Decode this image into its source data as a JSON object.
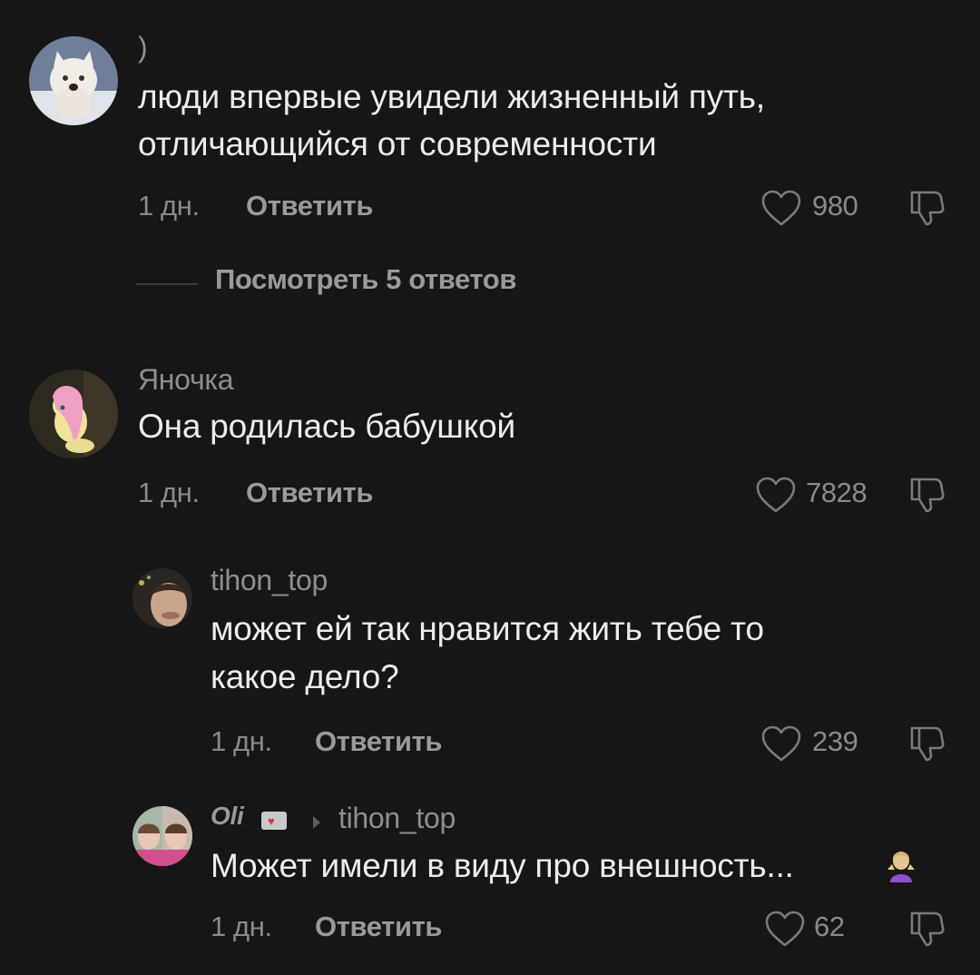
{
  "comments": [
    {
      "username": ")",
      "avatar": "white-cat-avatar",
      "lines": [
        "люди впервые увидели жизненный путь,",
        "отличающийся от современности"
      ],
      "time": "1 дн.",
      "reply_label": "Ответить",
      "likes": "980",
      "view_replies": "Посмотреть 5 ответов"
    },
    {
      "username": "Яночка",
      "avatar": "pony-avatar",
      "lines": [
        "Она родилась бабушкой"
      ],
      "time": "1 дн.",
      "reply_label": "Ответить",
      "likes": "7828"
    },
    {
      "username": "tihon_top",
      "avatar": "selfie-avatar",
      "lines": [
        "может ей так нравится жить тебе то",
        "какое дело?"
      ],
      "time": "1 дн.",
      "reply_label": "Ответить",
      "likes": "239"
    },
    {
      "username": "Oli",
      "badge": "heart-envelope-icon",
      "reply_to": "tihon_top",
      "avatar": "collage-avatar",
      "lines": [
        "Может имели в виду про внешность..."
      ],
      "emoji": "person-shrugging-emoji",
      "time": "1 дн.",
      "reply_label": "Ответить",
      "likes": "62"
    }
  ],
  "colors": {
    "background": "#161616",
    "text_primary": "#ececec",
    "text_secondary": "#8a8a8a",
    "heart_accent": "#d2344e"
  }
}
